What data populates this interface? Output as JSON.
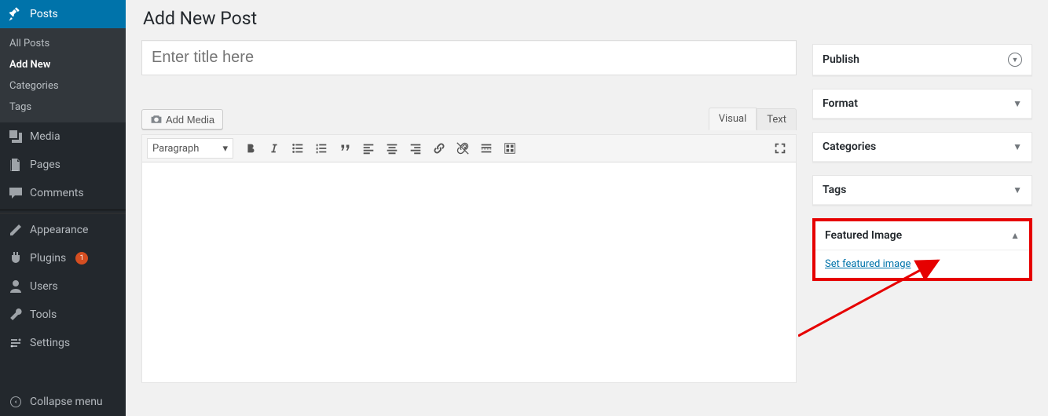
{
  "sidebar": {
    "posts": {
      "label": "Posts",
      "submenu": [
        "All Posts",
        "Add New",
        "Categories",
        "Tags"
      ],
      "current_sub_index": 1
    },
    "media": "Media",
    "pages": "Pages",
    "comments": "Comments",
    "appearance": "Appearance",
    "plugins": {
      "label": "Plugins",
      "badge": "1"
    },
    "users": "Users",
    "tools": "Tools",
    "settings": "Settings",
    "collapse": "Collapse menu"
  },
  "page": {
    "title": "Add New Post",
    "title_placeholder": "Enter title here",
    "add_media": "Add Media",
    "tabs": {
      "visual": "Visual",
      "text": "Text"
    },
    "format_select": "Paragraph"
  },
  "metaboxes": {
    "publish": "Publish",
    "format": "Format",
    "categories": "Categories",
    "tags": "Tags",
    "featured": {
      "title": "Featured Image",
      "link": "Set featured image"
    }
  }
}
